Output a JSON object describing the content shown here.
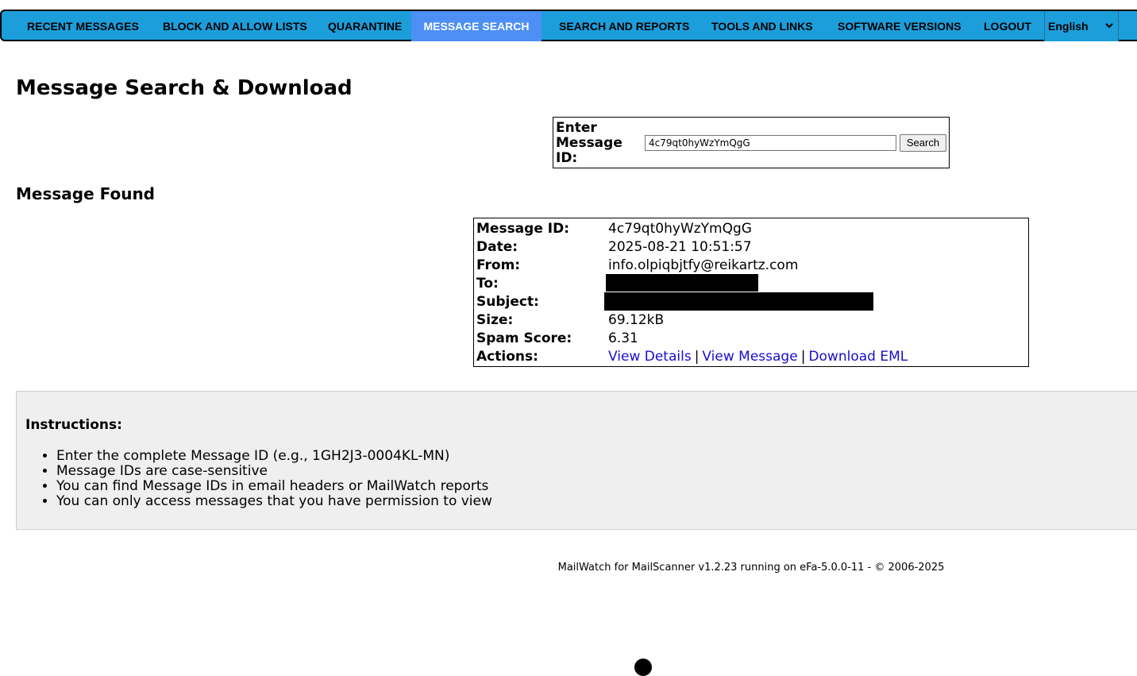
{
  "nav": {
    "items": [
      {
        "label": "RECENT MESSAGES",
        "active": false
      },
      {
        "label": "BLOCK AND ALLOW LISTS",
        "active": false
      },
      {
        "label": "QUARANTINE",
        "active": false
      },
      {
        "label": "MESSAGE SEARCH",
        "active": true
      },
      {
        "label": "SEARCH AND REPORTS",
        "active": false
      },
      {
        "label": "TOOLS AND LINKS",
        "active": false
      },
      {
        "label": "SOFTWARE VERSIONS",
        "active": false
      },
      {
        "label": "LOGOUT",
        "active": false
      }
    ],
    "language": "English",
    "bg_color": "#1c9edb",
    "active_color": "#4d8ff5"
  },
  "page": {
    "title": "Message Search & Download"
  },
  "search": {
    "label": "Enter Message ID:",
    "value": "4c79qt0hyWzYmQgG",
    "button": "Search"
  },
  "found": {
    "title": "Message Found",
    "rows": [
      {
        "key": "Message ID:",
        "value": "4c79qt0hyWzYmQgG"
      },
      {
        "key": "Date:",
        "value": "2025-08-21 10:51:57"
      },
      {
        "key": "From:",
        "value": "info.olpiqbjtfy@reikartz.com"
      },
      {
        "key": "To:",
        "value": ""
      },
      {
        "key": "Subject:",
        "value": ""
      },
      {
        "key": "Size:",
        "value": "69.12kB"
      },
      {
        "key": "Spam Score:",
        "value": "6.31"
      },
      {
        "key": "Actions:",
        "value": ""
      }
    ],
    "actions": {
      "view_details": "View Details",
      "view_message": "View Message",
      "download_eml": "Download EML",
      "separator": "|"
    },
    "link_color": "#1a0dcc"
  },
  "instructions": {
    "title": "Instructions:",
    "items": [
      "Enter the complete Message ID (e.g., 1GH2J3-0004KL-MN)",
      "Message IDs are case-sensitive",
      "You can find Message IDs in email headers or MailWatch reports",
      "You can only access messages that you have permission to view"
    ]
  },
  "footer": {
    "text": "MailWatch for MailScanner v1.2.23 running on eFa-5.0.0-11 - © 2006-2025"
  }
}
